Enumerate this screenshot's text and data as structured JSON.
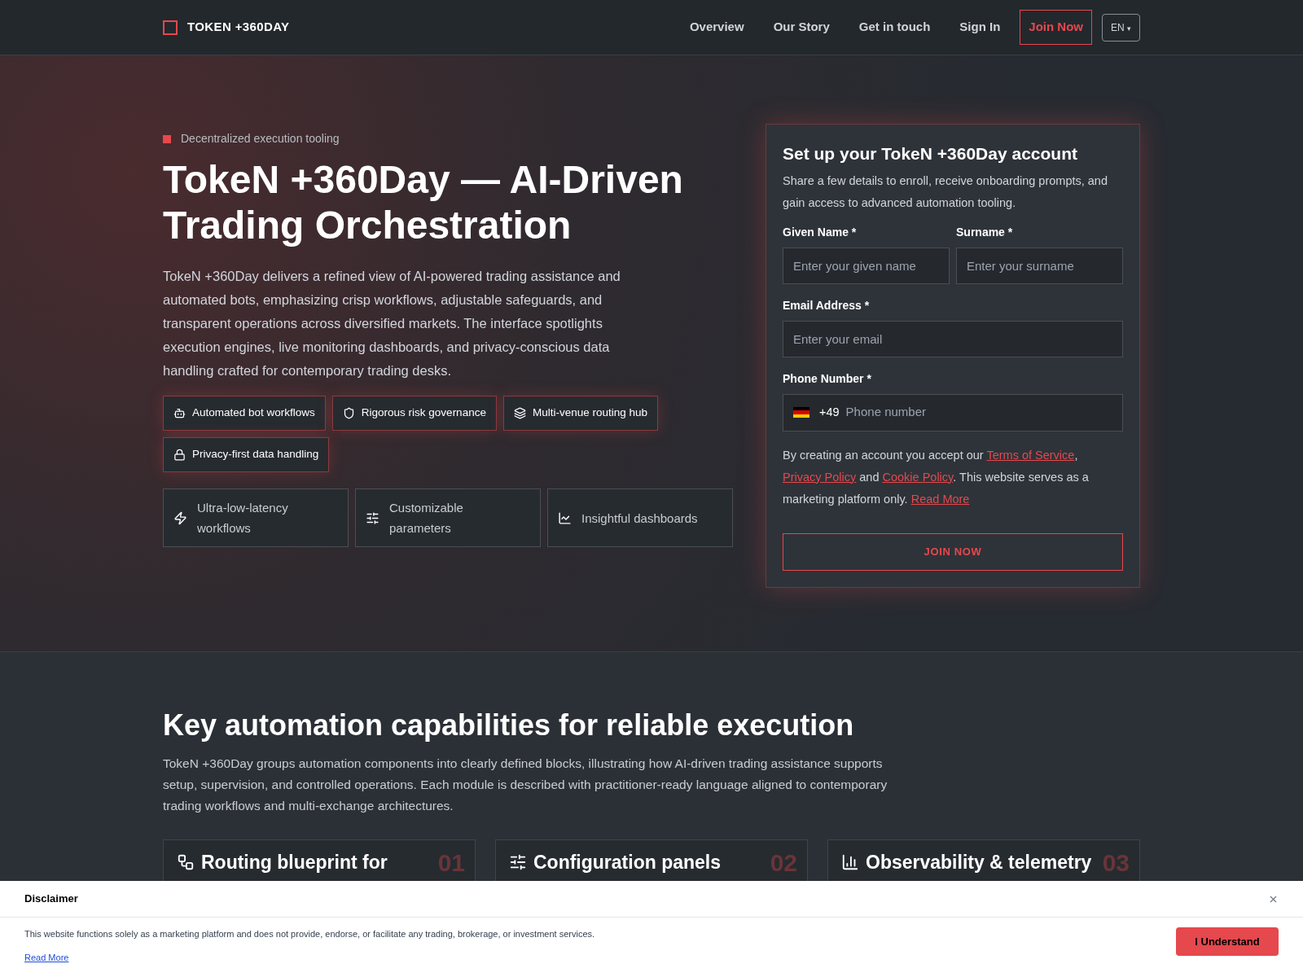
{
  "header": {
    "logo": "TOKEN +360DAY",
    "nav": [
      "Overview",
      "Our Story",
      "Get in touch",
      "Sign In"
    ],
    "cta": "Join Now",
    "language": "EN",
    "language_caret": "▾"
  },
  "hero": {
    "eyebrow": "Decentralized execution tooling",
    "title": "TokeN +360Day — AI-Driven Trading Orchestration",
    "description": "TokeN +360Day delivers a refined view of AI-powered trading assistance and automated bots, emphasizing crisp workflows, adjustable safeguards, and transparent operations across diversified markets. The interface spotlights execution engines, live monitoring dashboards, and privacy-conscious data handling crafted for contemporary trading desks.",
    "tags": [
      "Automated bot workflows",
      "Rigorous risk governance",
      "Multi-venue routing hub",
      "Privacy-first data handling"
    ],
    "features": [
      "Ultra-low-latency workflows",
      "Customizable parameters",
      "Insightful dashboards"
    ]
  },
  "form": {
    "title": "Set up your TokeN +360Day account",
    "subtitle": "Share a few details to enroll, receive onboarding prompts, and gain access to advanced automation tooling.",
    "given_name": {
      "label": "Given Name *",
      "placeholder": "Enter your given name"
    },
    "surname": {
      "label": "Surname *",
      "placeholder": "Enter your surname"
    },
    "email": {
      "label": "Email Address *",
      "placeholder": "Enter your email"
    },
    "phone": {
      "label": "Phone Number *",
      "dial_code": "+49",
      "placeholder": "Phone number"
    },
    "consent": [
      {
        "kind": "text",
        "text": "By creating an account you accept our "
      },
      {
        "kind": "link",
        "text": "Terms of Service"
      },
      {
        "kind": "text",
        "text": ", "
      },
      {
        "kind": "link",
        "text": "Privacy Policy"
      },
      {
        "kind": "text",
        "text": " and "
      },
      {
        "kind": "link",
        "text": "Cookie Policy"
      },
      {
        "kind": "text",
        "text": ". This website serves as a marketing platform only. "
      },
      {
        "kind": "link",
        "text": "Read More"
      }
    ],
    "submit": "JOIN NOW"
  },
  "capabilities": {
    "title": "Key automation capabilities for reliable execution",
    "description": "TokeN +360Day groups automation components into clearly defined blocks, illustrating how AI-driven trading assistance supports setup, supervision, and controlled operations. Each module is described with practitioner-ready language aligned to contemporary trading workflows and multi-exchange architectures.",
    "cards": [
      {
        "title": "Routing blueprint for",
        "number": "01"
      },
      {
        "title": "Configuration panels",
        "number": "02"
      },
      {
        "title": "Observability & telemetry",
        "number": "03"
      }
    ]
  },
  "disclaimer": {
    "title": "Disclaimer",
    "text": "This website functions solely as a marketing platform and does not provide, endorse, or facilitate any trading, brokerage, or investment services.",
    "link": "Read More",
    "button": "I Understand"
  }
}
